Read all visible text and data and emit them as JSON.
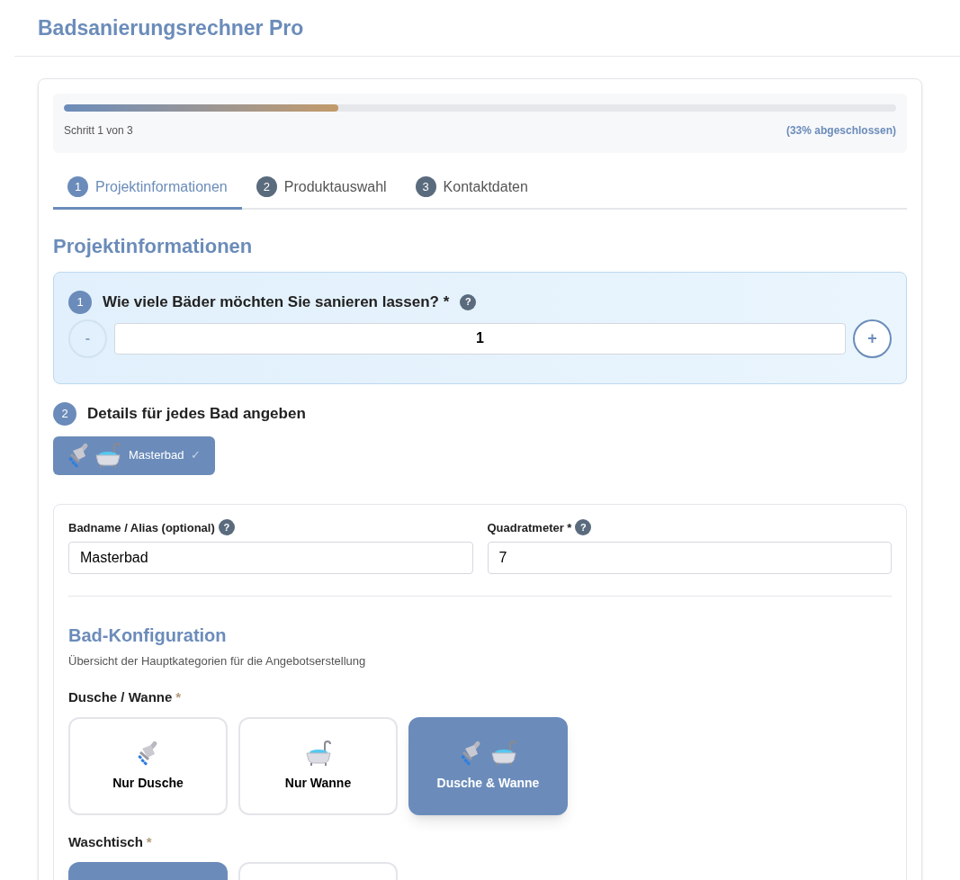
{
  "app_title": "Badsanierungsrechner Pro",
  "progress": {
    "level": 0.33,
    "step_label": "Schritt 1 von 3",
    "percent_label": "(33% abgeschlossen)"
  },
  "tabs": [
    {
      "number": "1",
      "label": "Projektinformationen",
      "selected": true
    },
    {
      "number": "2",
      "label": "Produktauswahl",
      "selected": false
    },
    {
      "number": "3",
      "label": "Kontaktdaten",
      "selected": false
    }
  ],
  "section_title": "Projektinformationen",
  "question1": {
    "number": "1",
    "label": "Wie viele Bäder möchten Sie sanieren lassen? *",
    "help": "?",
    "minus": "-",
    "minus_disabled": true,
    "value": "1",
    "plus": "+"
  },
  "question2": {
    "number": "2",
    "label": "Details für jedes Bad angeben"
  },
  "bath_tabs": [
    {
      "label": "Masterbad",
      "check": "✓",
      "selected": true
    }
  ],
  "fields": [
    {
      "label": "Badname / Alias (optional)",
      "help": "?",
      "value": "Masterbad"
    },
    {
      "label": "Quadratmeter *",
      "help": "?",
      "value": "7"
    }
  ],
  "config": {
    "title": "Bad-Konfiguration",
    "subtitle": "Übersicht der Hauptkategorien für die Angebotserstellung"
  },
  "groups": [
    {
      "label": "Dusche / Wanne",
      "required": "*",
      "options": [
        {
          "kind": "shower",
          "label": "Nur Dusche",
          "selected": false
        },
        {
          "kind": "tub",
          "label": "Nur Wanne",
          "selected": false
        },
        {
          "kind": "both",
          "label": "Dusche & Wanne",
          "selected": true
        }
      ]
    },
    {
      "label": "Waschtisch",
      "required": "*",
      "options": [
        {
          "kind": "blank",
          "selected": true
        },
        {
          "kind": "blank",
          "selected": false
        }
      ]
    }
  ]
}
